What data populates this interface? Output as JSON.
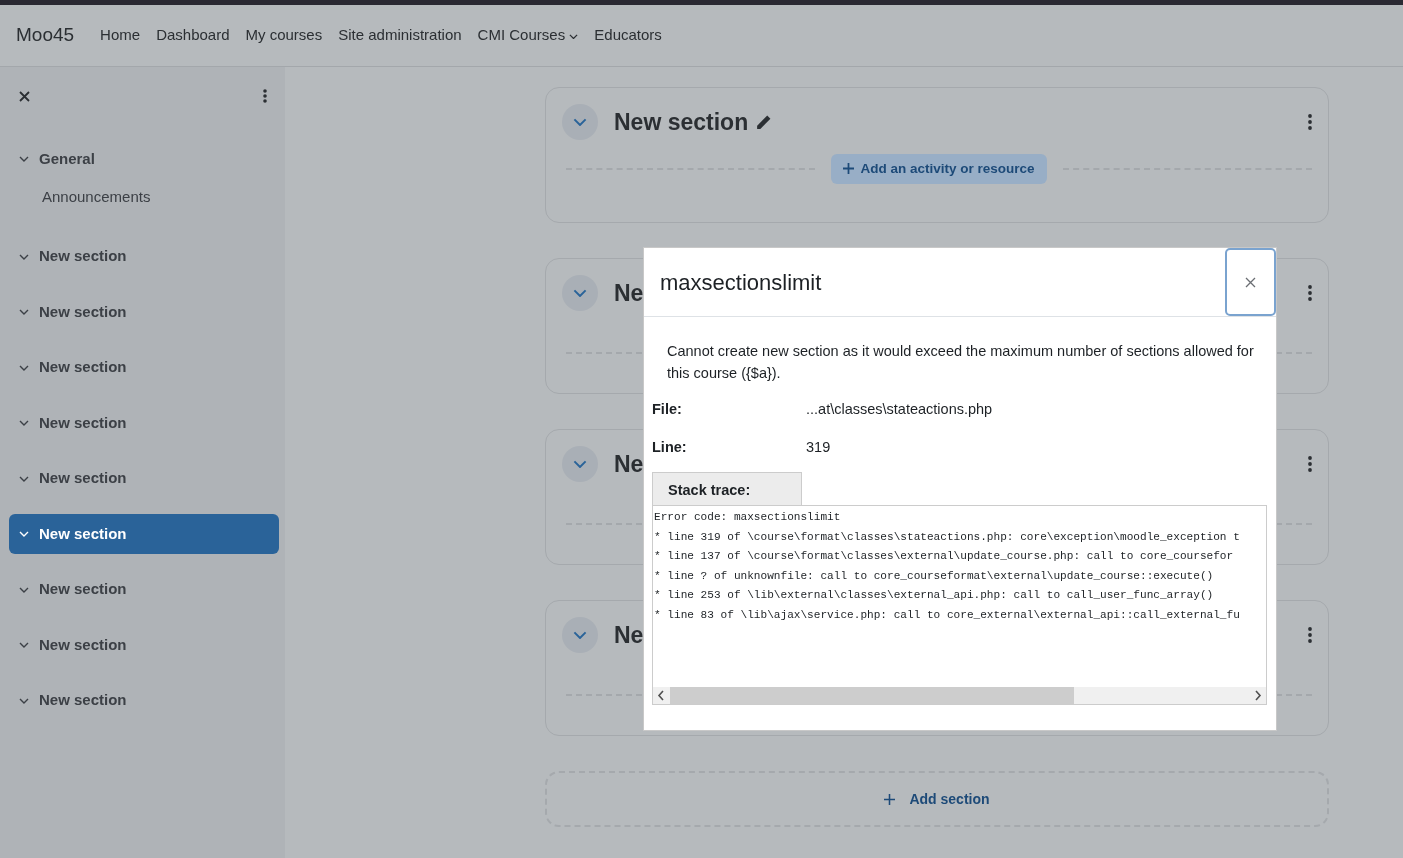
{
  "navbar": {
    "brand": "Moo45",
    "links": [
      {
        "label": "Home",
        "dropdown": false
      },
      {
        "label": "Dashboard",
        "dropdown": false
      },
      {
        "label": "My courses",
        "dropdown": false
      },
      {
        "label": "Site administration",
        "dropdown": false
      },
      {
        "label": "CMI Courses",
        "dropdown": true
      },
      {
        "label": "Educators",
        "dropdown": false
      }
    ]
  },
  "sidebar": {
    "items": [
      {
        "label": "General",
        "selected": false,
        "children": [
          {
            "label": "Announcements"
          }
        ]
      },
      {
        "label": "New section",
        "selected": false
      },
      {
        "label": "New section",
        "selected": false
      },
      {
        "label": "New section",
        "selected": false
      },
      {
        "label": "New section",
        "selected": false
      },
      {
        "label": "New section",
        "selected": false
      },
      {
        "label": "New section",
        "selected": true
      },
      {
        "label": "New section",
        "selected": false
      },
      {
        "label": "New section",
        "selected": false
      },
      {
        "label": "New section",
        "selected": false
      }
    ]
  },
  "sections": [
    {
      "title": "New section",
      "editable": true,
      "add_button": "Add an activity or resource"
    },
    {
      "title": "Ne"
    },
    {
      "title": "Ne"
    },
    {
      "title": "Ne"
    }
  ],
  "add_section": "Add section",
  "modal": {
    "title": "maxsectionslimit",
    "message": "Cannot create new section as it would exceed the maximum number of sections allowed for this course ({$a}).",
    "details": [
      {
        "label": "File:",
        "value": "...at\\classes\\stateactions.php"
      },
      {
        "label": "Line:",
        "value": "319"
      }
    ],
    "stack_tab": "Stack trace:",
    "stack_lines": [
      "Error code: maxsectionslimit",
      "* line 319 of \\course\\format\\classes\\stateactions.php: core\\exception\\moodle_exception t",
      "* line 137 of \\course\\format\\classes\\external\\update_course.php: call to core_coursefor",
      "* line ? of unknownfile: call to core_courseformat\\external\\update_course::execute()",
      "* line 253 of \\lib\\external\\classes\\external_api.php: call to call_user_func_array()",
      "* line 83 of \\lib\\ajax\\service.php: call to core_external\\external_api::call_external_fu"
    ]
  }
}
